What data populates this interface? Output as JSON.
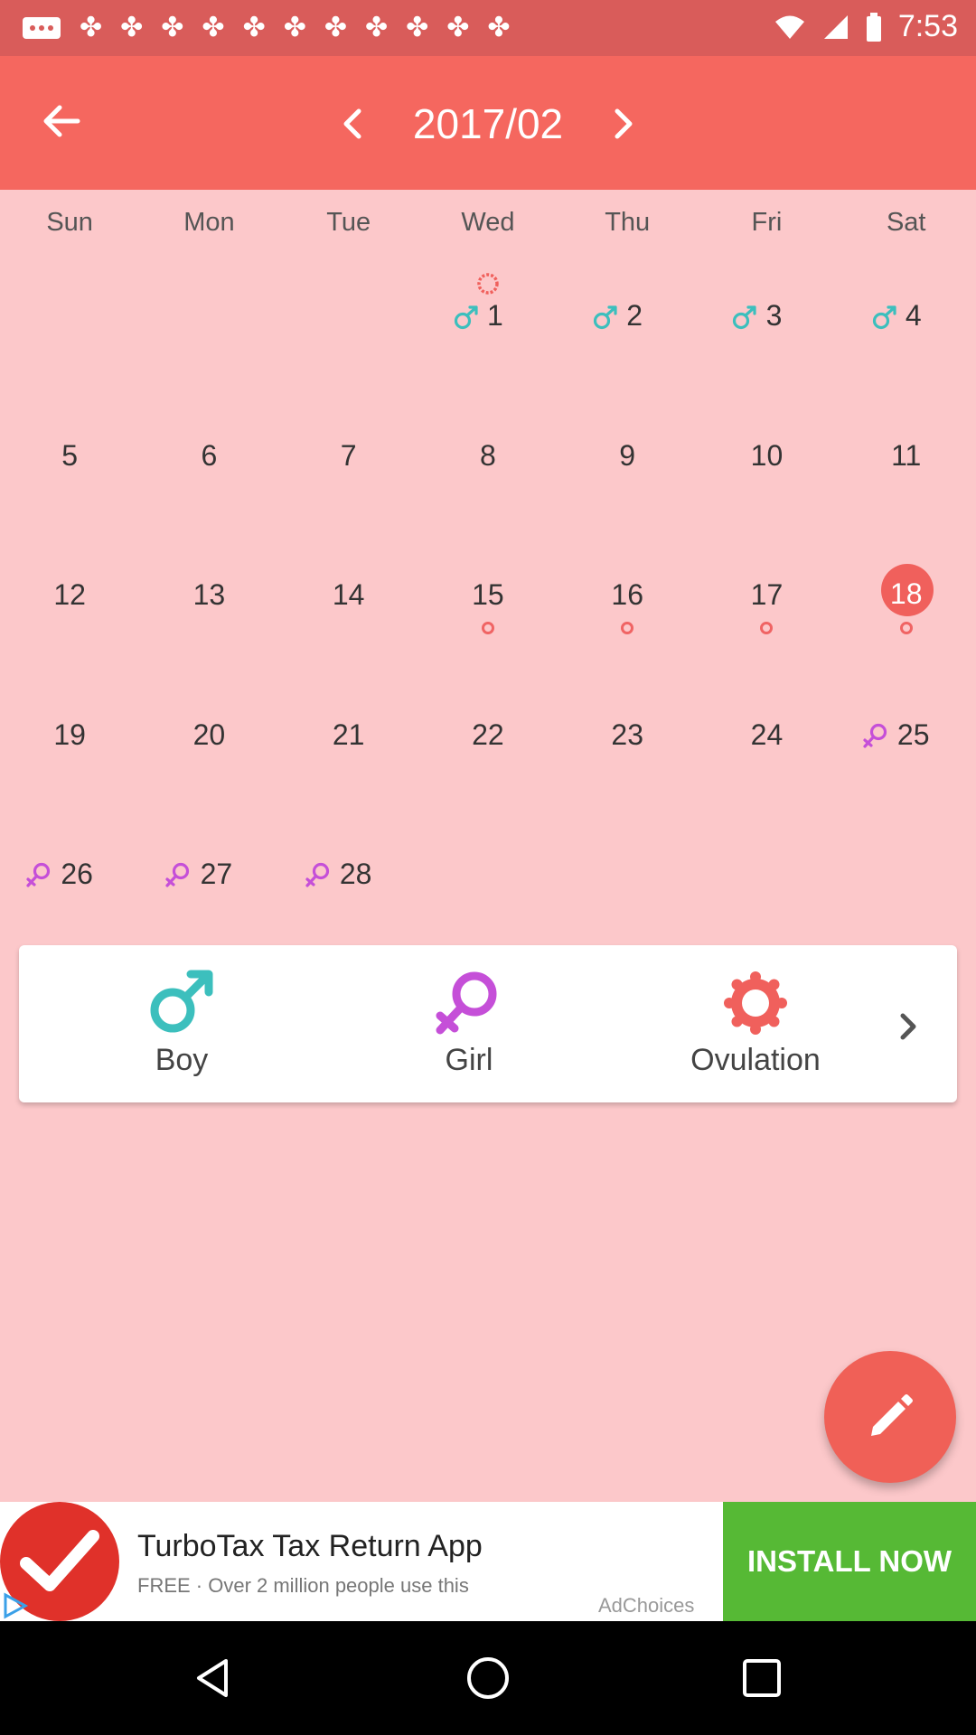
{
  "status_bar": {
    "time": "7:53",
    "icons": [
      "more-icon",
      "notification-icon",
      "notification-icon",
      "notification-icon",
      "notification-icon",
      "notification-icon",
      "notification-icon",
      "notification-icon",
      "notification-icon",
      "notification-icon",
      "notification-icon",
      "notification-icon",
      "wifi-icon",
      "signal-icon",
      "battery-icon"
    ]
  },
  "header": {
    "month_label": "2017/02"
  },
  "weekdays": [
    "Sun",
    "Mon",
    "Tue",
    "Wed",
    "Thu",
    "Fri",
    "Sat"
  ],
  "calendar": {
    "weeks": [
      [
        {
          "day": ""
        },
        {
          "day": ""
        },
        {
          "day": ""
        },
        {
          "day": "1",
          "marker": "boy",
          "ovulation": true
        },
        {
          "day": "2",
          "marker": "boy"
        },
        {
          "day": "3",
          "marker": "boy"
        },
        {
          "day": "4",
          "marker": "boy"
        }
      ],
      [
        {
          "day": "5"
        },
        {
          "day": "6"
        },
        {
          "day": "7"
        },
        {
          "day": "8"
        },
        {
          "day": "9"
        },
        {
          "day": "10"
        },
        {
          "day": "11"
        }
      ],
      [
        {
          "day": "12"
        },
        {
          "day": "13"
        },
        {
          "day": "14"
        },
        {
          "day": "15",
          "dot": true
        },
        {
          "day": "16",
          "dot": true
        },
        {
          "day": "17",
          "dot": true
        },
        {
          "day": "18",
          "dot": true,
          "today": true
        }
      ],
      [
        {
          "day": "19"
        },
        {
          "day": "20"
        },
        {
          "day": "21"
        },
        {
          "day": "22"
        },
        {
          "day": "23"
        },
        {
          "day": "24"
        },
        {
          "day": "25",
          "marker": "girl"
        }
      ],
      [
        {
          "day": "26",
          "marker": "girl"
        },
        {
          "day": "27",
          "marker": "girl"
        },
        {
          "day": "28",
          "marker": "girl"
        },
        {
          "day": ""
        },
        {
          "day": ""
        },
        {
          "day": ""
        },
        {
          "day": ""
        }
      ]
    ]
  },
  "legend": {
    "boy_label": "Boy",
    "girl_label": "Girl",
    "ovulation_label": "Ovulation"
  },
  "ad": {
    "title": "TurboTax Tax Return App",
    "subtitle": "FREE · Over 2 million people use this",
    "choices": "AdChoices",
    "cta": "INSTALL NOW"
  },
  "colors": {
    "app_bar": "#f5675f",
    "background": "#fcc8ca",
    "boy": "#3cbfbd",
    "girl": "#c54fd8",
    "ovulation": "#f0605c",
    "install": "#56b935"
  }
}
